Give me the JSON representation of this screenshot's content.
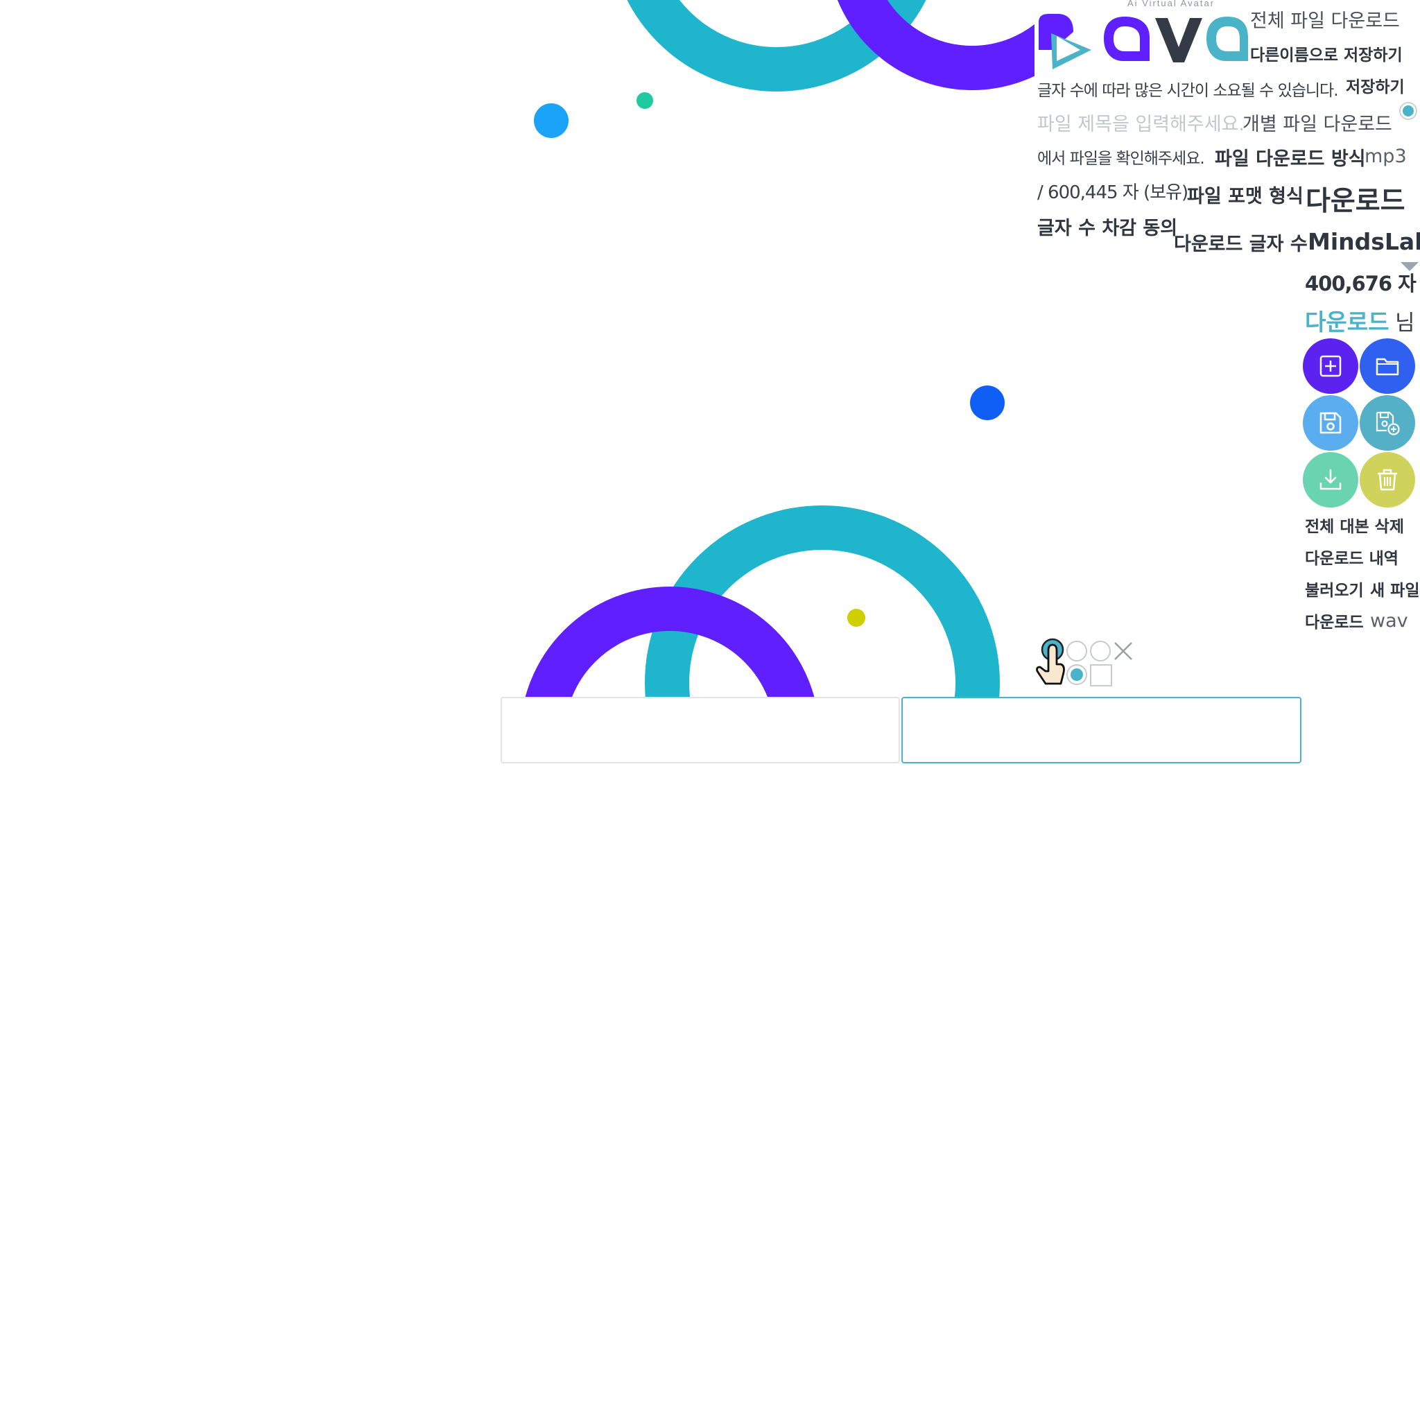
{
  "logo": {
    "tagline": "Ai Virtual Avatar",
    "wordmark": "ava"
  },
  "labels": {
    "download_all": "전체 파일 다운로드",
    "save_as": "다른이름으로 저장하기",
    "long_time_notice": "글자 수에 따라 많은 시간이 소요될 수 있습니다.",
    "save": "저장하기",
    "title_placeholder": "파일 제목을 입력해주세요.",
    "download_each": "개별 파일 다운로드",
    "check_file_in": "에서 파일을 확인해주세요.",
    "download_method": "파일 다운로드 방식",
    "format_mp3": "mp3",
    "owned_chars": "/ 600,445 자 (보유)",
    "file_format": "파일 포맷 형식",
    "download_title": "다운로드",
    "deduct_agree": "글자 수 차감 동의",
    "download_char_count": "다운로드 글자 수",
    "user_name": "MindsLab",
    "char_count": "400,676 자",
    "download_accent": "다운로드",
    "honorific": "님",
    "delete_all_script": "전체 대본 삭제",
    "download_history": "다운로드 내역",
    "load": "불러오기",
    "new_file": "새 파일",
    "download_small": "다운로드",
    "format_wav": "wav"
  },
  "toolbar": {
    "buttons": [
      {
        "name": "new-file-button",
        "icon": "plus-square-icon",
        "color": "#5b22f0"
      },
      {
        "name": "open-folder-button",
        "icon": "folder-icon",
        "color": "#3060f0"
      },
      {
        "name": "save-button",
        "icon": "floppy-icon",
        "color": "#5aaef0"
      },
      {
        "name": "save-as-button",
        "icon": "floppy-plus-icon",
        "color": "#53b0c6"
      },
      {
        "name": "download-button",
        "icon": "download-icon",
        "color": "#6ad3b0"
      },
      {
        "name": "delete-button",
        "icon": "trash-icon",
        "color": "#cfd35c"
      }
    ]
  },
  "colors": {
    "purple": "#5f1fff",
    "teal": "#1fb5cc",
    "accent": "#4ab3c8",
    "blue_dot": "#1aa3f8",
    "green_dot": "#1fcaa0",
    "yellow_dot": "#cfcf00",
    "royal_dot": "#0f5ff5"
  }
}
